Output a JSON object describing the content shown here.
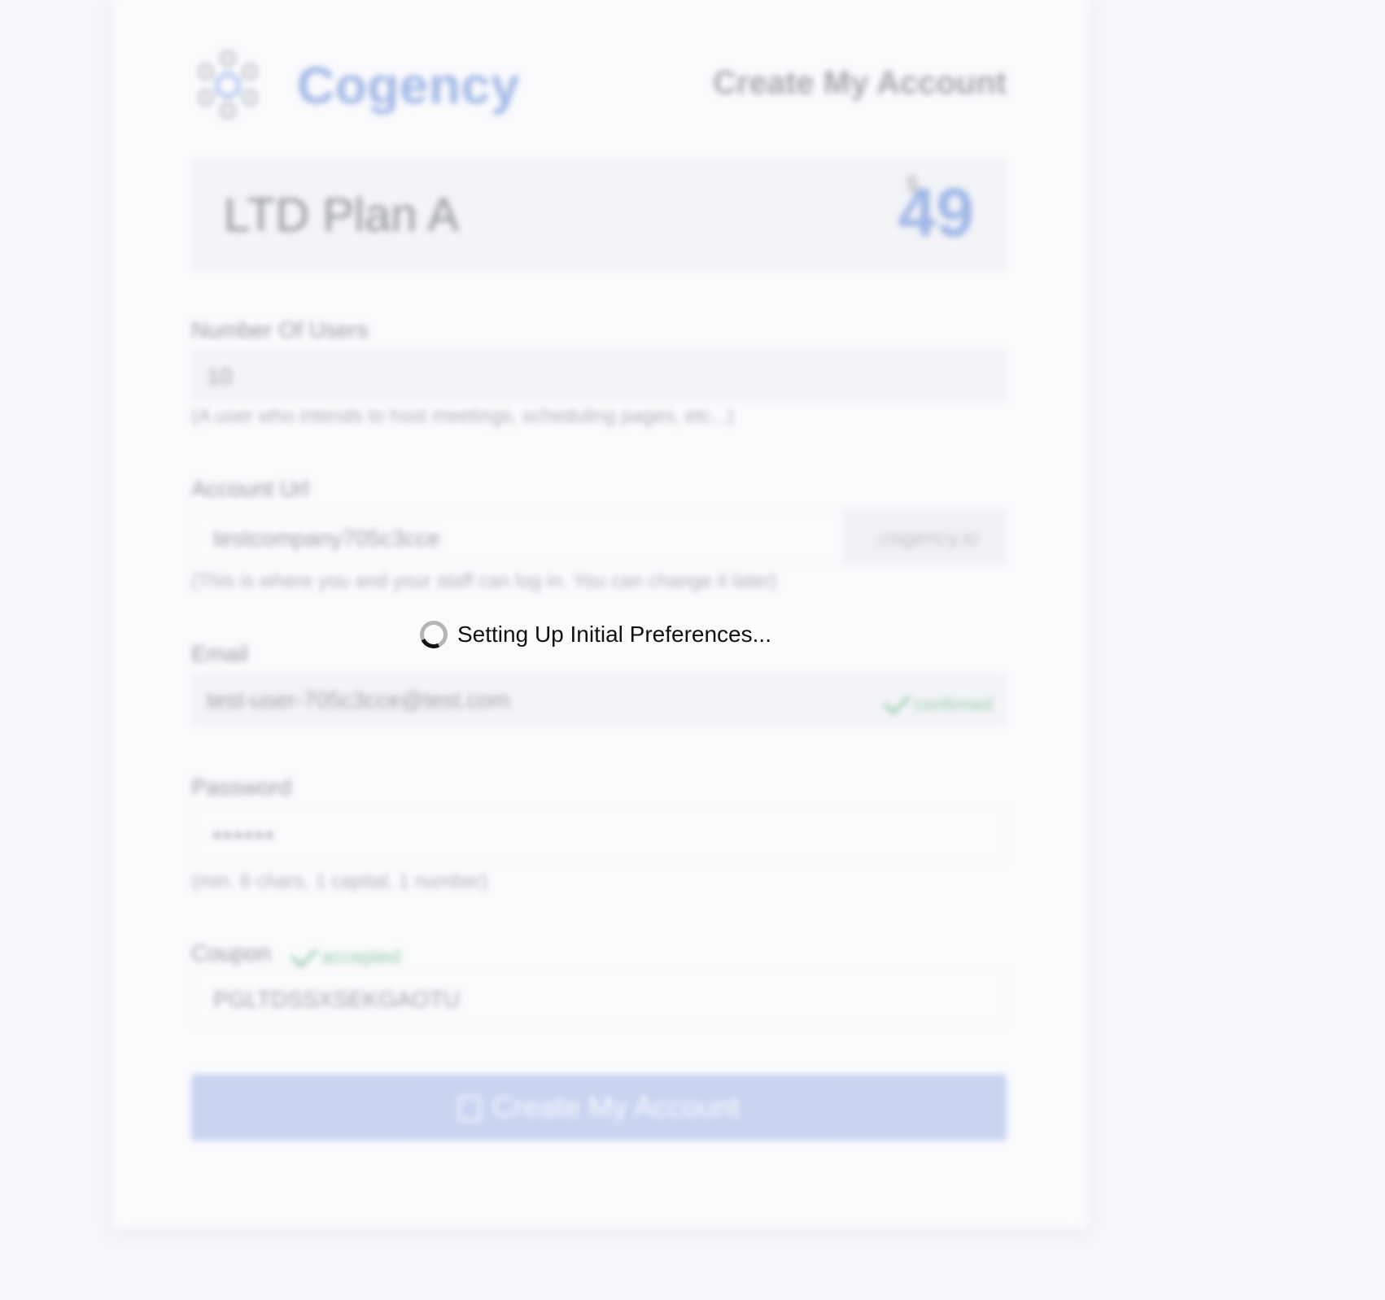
{
  "header": {
    "brand": "Cogency",
    "title": "Create My Account"
  },
  "plan": {
    "name": "LTD Plan A",
    "currency": "$",
    "price": "49"
  },
  "form": {
    "users": {
      "label": "Number Of Users",
      "value": "10",
      "hint": "(A user who intends to host meetings, scheduling pages, etc...)"
    },
    "account_url": {
      "label": "Account Url",
      "value": "testcompany705c3cce",
      "suffix": ".cogency.io",
      "hint": "(This is where you and your staff can log in. You can change it later)"
    },
    "email": {
      "label": "Email",
      "value": "test-user-705c3cce@test.com",
      "status": "confirmed"
    },
    "password": {
      "label": "Password",
      "value": "••••••",
      "hint": "(min. 6 chars, 1 capital, 1 number)"
    },
    "coupon": {
      "label": "Coupon",
      "status": "accepted",
      "value": "PGLTDSSXSEKGAOTU"
    },
    "submit_label": "Create My Account"
  },
  "loading": {
    "text": "Setting Up Initial Preferences..."
  },
  "colors": {
    "accent": "#4a78d4",
    "success": "#3aa35a",
    "background": "#f6f7fb"
  }
}
